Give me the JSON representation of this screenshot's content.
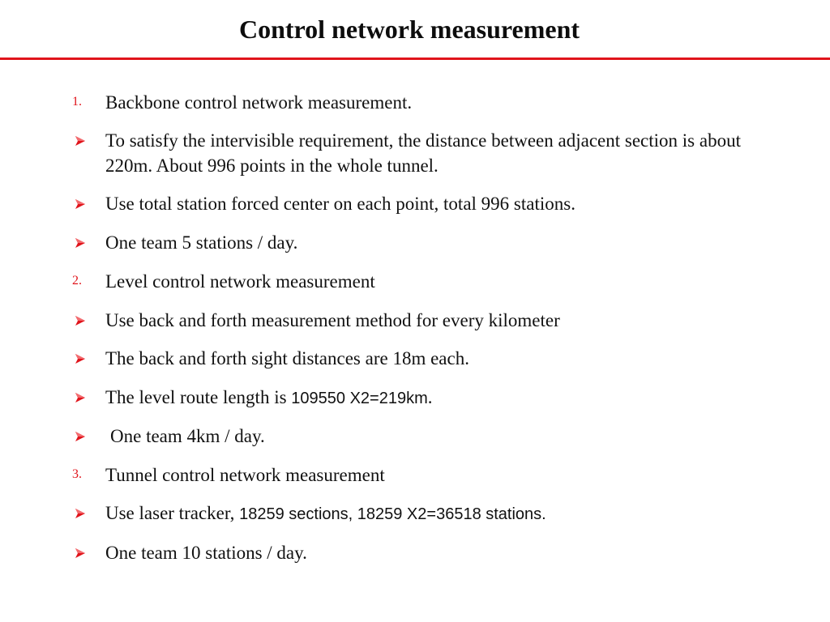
{
  "slide": {
    "title": "Control network measurement",
    "accent_color": "#e0141b",
    "items": [
      {
        "type": "number",
        "marker": "1.",
        "text": "Backbone control network measurement."
      },
      {
        "type": "bullet",
        "marker_icon": "arrowhead-bullet",
        "text": "To satisfy the intervisible requirement, the distance between adjacent section is about 220m.  About 996 points in the whole tunnel."
      },
      {
        "type": "bullet",
        "marker_icon": "arrowhead-bullet",
        "text": "Use total station forced center on each point, total 996 stations."
      },
      {
        "type": "bullet",
        "marker_icon": "arrowhead-bullet",
        "text": "One team  5 stations / day."
      },
      {
        "type": "number",
        "marker": "2.",
        "text": "Level control network measurement"
      },
      {
        "type": "bullet",
        "marker_icon": "arrowhead-bullet",
        "text": "Use back and forth measurement method for every kilometer"
      },
      {
        "type": "bullet",
        "marker_icon": "arrowhead-bullet",
        "text": "The back and forth  sight distances are 18m each."
      },
      {
        "type": "bullet",
        "marker_icon": "arrowhead-bullet",
        "text_serif": "The level route length is ",
        "text_sans": "109550 X2=219km",
        "text_tail": "."
      },
      {
        "type": "bullet",
        "marker_icon": "arrowhead-bullet",
        "text": "One team 4km / day."
      },
      {
        "type": "number",
        "marker": "3.",
        "text": "Tunnel control network measurement"
      },
      {
        "type": "bullet",
        "marker_icon": "arrowhead-bullet",
        "text_serif": "Use laser tracker, ",
        "text_sans": "18259 sections, 18259 X2=36518 stations."
      },
      {
        "type": "bullet",
        "marker_icon": "arrowhead-bullet",
        "text": "One team 10 stations / day."
      }
    ]
  }
}
